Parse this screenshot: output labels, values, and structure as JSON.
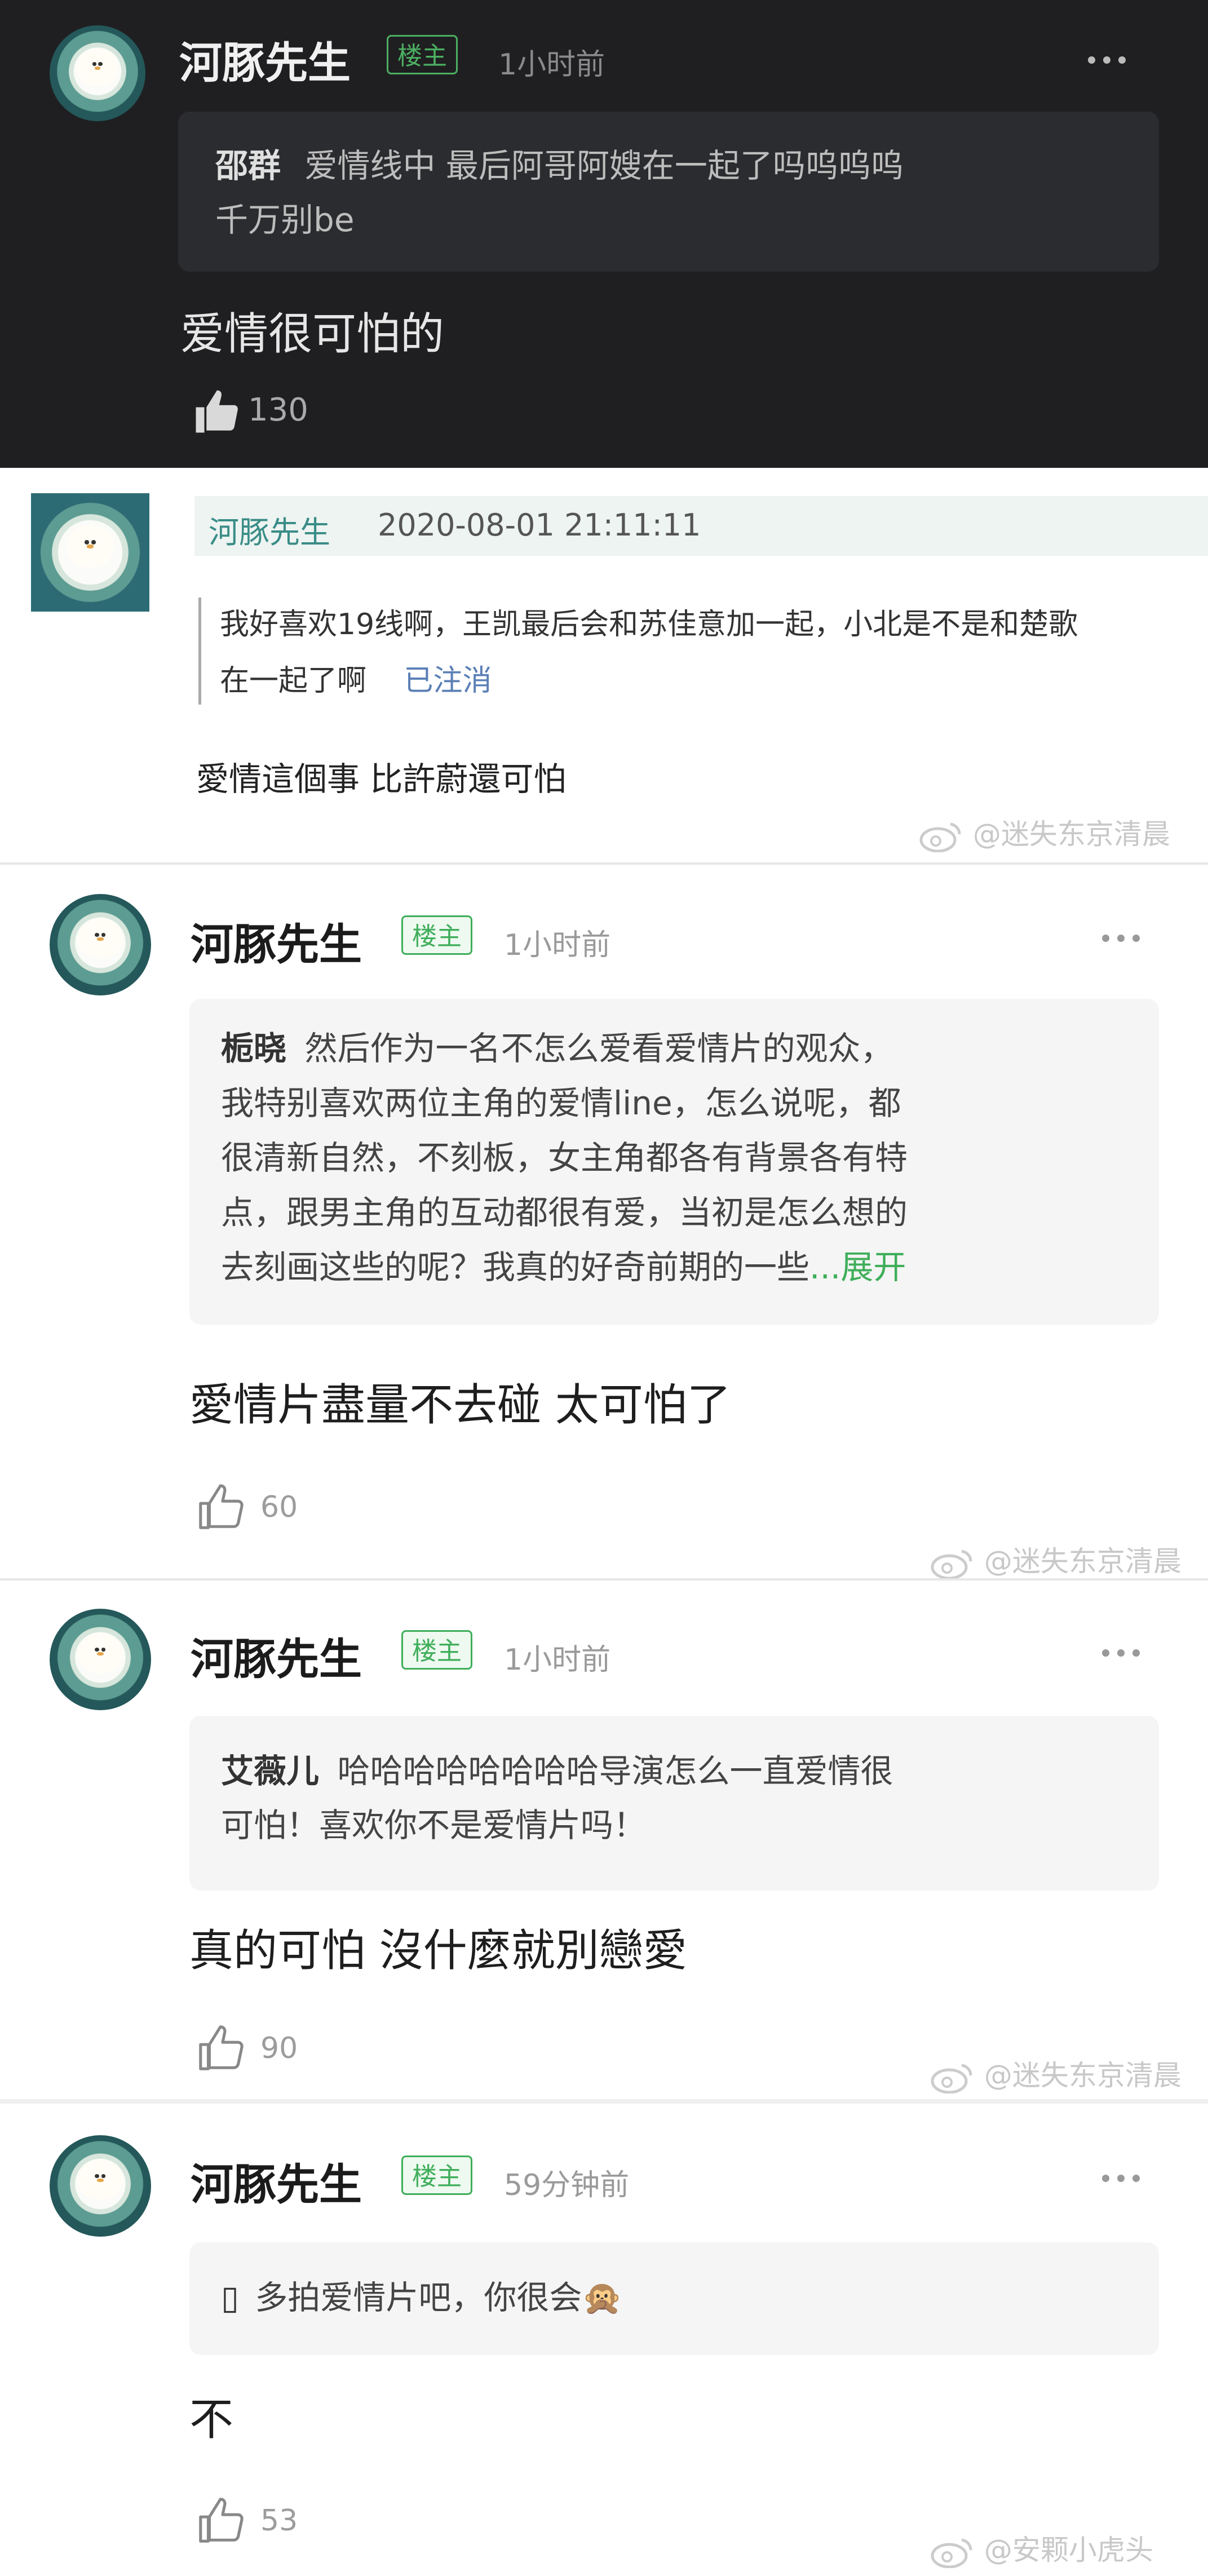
{
  "c1": {
    "author": "河豚先生",
    "badge": "楼主",
    "time": "1小时前",
    "quote_user": "邵群",
    "quote_line1": "爱情线中 最后阿哥阿嫂在一起了吗呜呜呜",
    "quote_line2": "千万别be",
    "reply": "爱情很可怕的",
    "likes": "130"
  },
  "c2": {
    "author": "河豚先生",
    "datetime": "2020-08-01 21:11:11",
    "quote_line1": "我好喜欢19线啊，王凯最后会和苏佳意加一起，小北是不是和楚歌",
    "quote_line2": "在一起了啊",
    "quote_status": "已注消",
    "reply": "愛情這個事 比許蔚還可怕",
    "watermark": "@迷失东京清晨"
  },
  "c3": {
    "author": "河豚先生",
    "badge": "楼主",
    "time": "1小时前",
    "quote_user": "栀晓",
    "quote_line1": "然后作为一名不怎么爱看爱情片的观众，",
    "quote_line2": "我特别喜欢两位主角的爱情line，怎么说呢，都",
    "quote_line3": "很清新自然，不刻板，女主角都各有背景各有特",
    "quote_line4": "点，跟男主角的互动都很有爱，当初是怎么想的",
    "quote_line5": "去刻画这些的呢？我真的好奇前期的一些",
    "expand": "...展开",
    "reply": "愛情片盡量不去碰 太可怕了",
    "likes": "60",
    "watermark": "@迷失东京清晨"
  },
  "c4": {
    "author": "河豚先生",
    "badge": "楼主",
    "time": "1小时前",
    "quote_user": "艾薇儿",
    "quote_line1": "哈哈哈哈哈哈哈哈导演怎么一直爱情很",
    "quote_line2": "可怕！喜欢你不是爱情片吗！",
    "reply": "真的可怕 沒什麼就別戀愛",
    "likes": "90",
    "watermark": "@迷失东京清晨"
  },
  "c5": {
    "author": "河豚先生",
    "badge": "楼主",
    "time": "59分钟前",
    "quote_user": "▯",
    "quote_text": "多拍爱情片吧，你很会🙊",
    "reply": "不",
    "likes": "53",
    "watermark": "@安颗小虎头"
  },
  "icons": [
    "avatar",
    "more-icon",
    "thumbs-up-icon",
    "weibo-logo-icon"
  ],
  "colors": {
    "dark_bg": "#1f1f21",
    "badge_green": "#3fae5a",
    "link_blue": "#5a7fb6",
    "expand_green": "#3fae5a"
  }
}
